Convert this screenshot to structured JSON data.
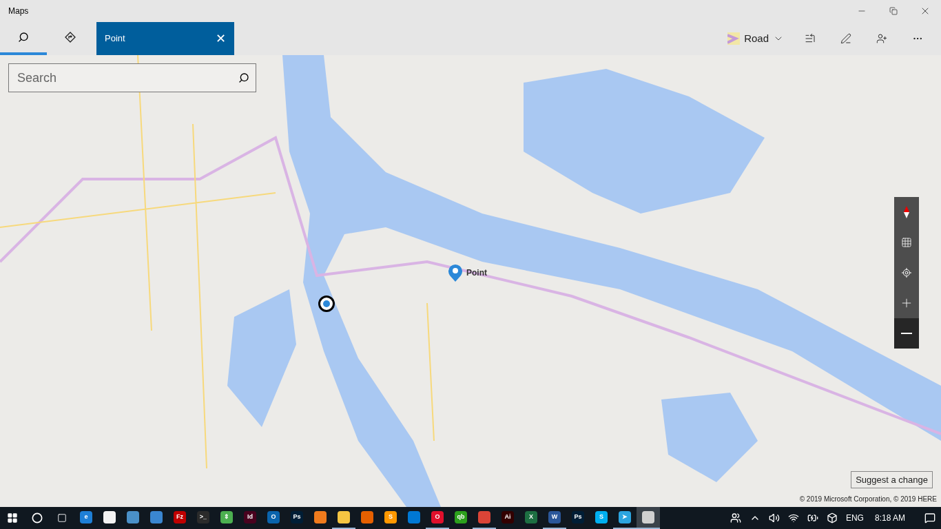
{
  "window": {
    "title": "Maps"
  },
  "nav_tabs": [
    {
      "kind": "search",
      "selected": true
    },
    {
      "kind": "directions",
      "selected": false
    }
  ],
  "open_tab": {
    "label": "Point",
    "close": "✕"
  },
  "toolbar": {
    "map_style": "Road"
  },
  "search": {
    "placeholder": "Search"
  },
  "pin": {
    "label": "Point"
  },
  "suggest_button": "Suggest a change",
  "copyright": "© 2019 Microsoft Corporation, © 2019 HERE",
  "taskbar": {
    "apps": [
      {
        "glyph": "e",
        "color": "#1e7fd6",
        "running": false,
        "selected": false
      },
      {
        "color": "#f3f3f3",
        "running": false,
        "selected": false
      },
      {
        "color": "#4a90c8",
        "running": false,
        "selected": false
      },
      {
        "color": "#3a86d0",
        "running": false,
        "selected": false
      },
      {
        "glyph": "Fz",
        "color": "#bf0000",
        "running": false,
        "selected": false
      },
      {
        "glyph": ">_",
        "color": "#2b2b2b",
        "running": false,
        "selected": false
      },
      {
        "glyph": "⇕",
        "color": "#4caf50",
        "running": false,
        "selected": false
      },
      {
        "glyph": "Id",
        "color": "#49021f",
        "running": false,
        "selected": false
      },
      {
        "glyph": "O",
        "color": "#0a64ad",
        "running": false,
        "selected": false
      },
      {
        "glyph": "Ps",
        "color": "#001e36",
        "running": false,
        "selected": false
      },
      {
        "color": "#f07b1d",
        "running": false,
        "selected": false
      },
      {
        "color": "#f5c542",
        "running": true,
        "selected": false
      },
      {
        "color": "#e66000",
        "running": false,
        "selected": false
      },
      {
        "glyph": "S",
        "color": "#ff9800",
        "running": false,
        "selected": false
      },
      {
        "color": "#0078d4",
        "running": false,
        "selected": false
      },
      {
        "glyph": "O",
        "color": "#e0102c",
        "running": true,
        "selected": false
      },
      {
        "glyph": "qb",
        "color": "#2ca01c",
        "running": false,
        "selected": false
      },
      {
        "color": "#db4437",
        "running": true,
        "selected": false
      },
      {
        "glyph": "Ai",
        "color": "#330000",
        "running": false,
        "selected": false
      },
      {
        "glyph": "X",
        "color": "#1d6f42",
        "running": false,
        "selected": false
      },
      {
        "glyph": "W",
        "color": "#2b579a",
        "running": true,
        "selected": false
      },
      {
        "glyph": "Ps",
        "color": "#001e36",
        "running": false,
        "selected": false
      },
      {
        "glyph": "S",
        "color": "#00aff0",
        "running": false,
        "selected": false
      },
      {
        "glyph": "➤",
        "color": "#2ca5e0",
        "running": true,
        "selected": false
      },
      {
        "color": "#d0d0d0",
        "running": true,
        "selected": true
      }
    ],
    "language": "ENG",
    "time": "8:18 AM"
  }
}
